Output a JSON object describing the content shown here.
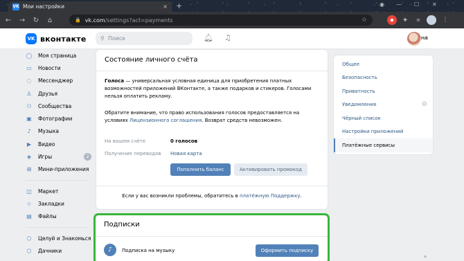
{
  "browser": {
    "tab_title": "Мои настройки",
    "tab_favicon": "VK",
    "url_domain": "vk.com",
    "url_path": "/settings?act=payments",
    "tab_close": "×",
    "new_tab": "+",
    "back": "←",
    "forward": "→",
    "reload": "↻",
    "home": "⌂"
  },
  "header": {
    "logo_mark": "VK",
    "logo_text": "вконтакте",
    "search_placeholder": "Поиск",
    "user_name": "Анна"
  },
  "left_nav": {
    "items": [
      {
        "label": "Моя страница",
        "icon": "user-icon"
      },
      {
        "label": "Новости",
        "icon": "news-icon"
      },
      {
        "label": "Мессенджер",
        "icon": "messenger-icon"
      },
      {
        "label": "Друзья",
        "icon": "friends-icon"
      },
      {
        "label": "Сообщества",
        "icon": "communities-icon"
      },
      {
        "label": "Фотографии",
        "icon": "photo-icon"
      },
      {
        "label": "Музыка",
        "icon": "music-icon"
      },
      {
        "label": "Видео",
        "icon": "video-icon"
      },
      {
        "label": "Игры",
        "icon": "games-icon",
        "badge": "2"
      },
      {
        "label": "Мини-приложения",
        "icon": "apps-icon"
      }
    ],
    "items2": [
      {
        "label": "Маркет",
        "icon": "market-icon"
      },
      {
        "label": "Закладки",
        "icon": "bookmarks-icon"
      },
      {
        "label": "Файлы",
        "icon": "files-icon"
      }
    ],
    "items3": [
      {
        "label": "Целуй и Знакомься",
        "icon": "app-icon"
      },
      {
        "label": "Дачники",
        "icon": "game-icon"
      }
    ]
  },
  "account": {
    "title": "Состояние личного счёта",
    "description_bold": "Голоса",
    "description_rest": " — универсальная условная единица для приобретения платных возможностей приложений ВКонтакте, а также подарков и стикеров. Голосами нельзя оплатить рекламу.",
    "notice_start": "Обратите внимание, что право использования голосов предоставляется на условиях ",
    "notice_link": "Лицензионного соглашения",
    "notice_end": ". Возврат средств невозможен.",
    "balance_label": "На вашем счёте",
    "balance_value": "0 голосов",
    "transfers_label": "Получение переводов",
    "transfers_value": "Новая карта",
    "topup_button": "Пополнить баланс",
    "promo_button": "Активировать промокод",
    "help_text": "Если у вас возникли проблемы, обратитесь в ",
    "help_link": "платёжную Поддержку",
    "help_end": "."
  },
  "subscriptions": {
    "title": "Подписки",
    "item_label": "Подписка на музыку",
    "item_button": "Оформить подписку"
  },
  "settings_menu": {
    "items": [
      "Общее",
      "Безопасность",
      "Приватность",
      "Уведомления",
      "Чёрный список",
      "Настройки приложений",
      "Платёжные сервисы"
    ],
    "active_index": 6
  },
  "colors": {
    "vk_blue": "#0077ff",
    "button_blue": "#5181b8",
    "link": "#2a5885",
    "highlight_green": "#3ab53a"
  }
}
